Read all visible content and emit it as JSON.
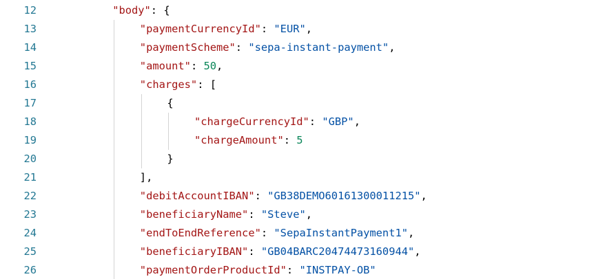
{
  "editor": {
    "lines": [
      {
        "number": "12",
        "indent": 2,
        "tokens": [
          {
            "t": "key",
            "v": "\"body\""
          },
          {
            "t": "pun",
            "v": ": {"
          }
        ]
      },
      {
        "number": "13",
        "indent": 3,
        "tokens": [
          {
            "t": "key",
            "v": "\"paymentCurrencyId\""
          },
          {
            "t": "pun",
            "v": ": "
          },
          {
            "t": "str",
            "v": "\"EUR\""
          },
          {
            "t": "pun",
            "v": ","
          }
        ]
      },
      {
        "number": "14",
        "indent": 3,
        "tokens": [
          {
            "t": "key",
            "v": "\"paymentScheme\""
          },
          {
            "t": "pun",
            "v": ": "
          },
          {
            "t": "str",
            "v": "\"sepa-instant-payment\""
          },
          {
            "t": "pun",
            "v": ","
          }
        ]
      },
      {
        "number": "15",
        "indent": 3,
        "tokens": [
          {
            "t": "key",
            "v": "\"amount\""
          },
          {
            "t": "pun",
            "v": ": "
          },
          {
            "t": "num",
            "v": "50"
          },
          {
            "t": "pun",
            "v": ","
          }
        ]
      },
      {
        "number": "16",
        "indent": 3,
        "tokens": [
          {
            "t": "key",
            "v": "\"charges\""
          },
          {
            "t": "pun",
            "v": ": ["
          }
        ]
      },
      {
        "number": "17",
        "indent": 4,
        "tokens": [
          {
            "t": "pun",
            "v": "{"
          }
        ]
      },
      {
        "number": "18",
        "indent": 5,
        "tokens": [
          {
            "t": "key",
            "v": "\"chargeCurrencyId\""
          },
          {
            "t": "pun",
            "v": ": "
          },
          {
            "t": "str",
            "v": "\"GBP\""
          },
          {
            "t": "pun",
            "v": ","
          }
        ]
      },
      {
        "number": "19",
        "indent": 5,
        "tokens": [
          {
            "t": "key",
            "v": "\"chargeAmount\""
          },
          {
            "t": "pun",
            "v": ": "
          },
          {
            "t": "num",
            "v": "5"
          }
        ]
      },
      {
        "number": "20",
        "indent": 4,
        "tokens": [
          {
            "t": "pun",
            "v": "}"
          }
        ]
      },
      {
        "number": "21",
        "indent": 3,
        "tokens": [
          {
            "t": "pun",
            "v": "],"
          }
        ]
      },
      {
        "number": "22",
        "indent": 3,
        "tokens": [
          {
            "t": "key",
            "v": "\"debitAccountIBAN\""
          },
          {
            "t": "pun",
            "v": ": "
          },
          {
            "t": "str",
            "v": "\"GB38DEMO60161300011215\""
          },
          {
            "t": "pun",
            "v": ","
          }
        ]
      },
      {
        "number": "23",
        "indent": 3,
        "tokens": [
          {
            "t": "key",
            "v": "\"beneficiaryName\""
          },
          {
            "t": "pun",
            "v": ": "
          },
          {
            "t": "str",
            "v": "\"Steve\""
          },
          {
            "t": "pun",
            "v": ","
          }
        ]
      },
      {
        "number": "24",
        "indent": 3,
        "tokens": [
          {
            "t": "key",
            "v": "\"endToEndReference\""
          },
          {
            "t": "pun",
            "v": ": "
          },
          {
            "t": "str",
            "v": "\"SepaInstantPayment1\""
          },
          {
            "t": "pun",
            "v": ","
          }
        ]
      },
      {
        "number": "25",
        "indent": 3,
        "tokens": [
          {
            "t": "key",
            "v": "\"beneficiaryIBAN\""
          },
          {
            "t": "pun",
            "v": ": "
          },
          {
            "t": "str",
            "v": "\"GB04BARC20474473160944\""
          },
          {
            "t": "pun",
            "v": ","
          }
        ]
      },
      {
        "number": "26",
        "indent": 3,
        "tokens": [
          {
            "t": "key",
            "v": "\"paymentOrderProductId\""
          },
          {
            "t": "pun",
            "v": ": "
          },
          {
            "t": "str",
            "v": "\"INSTPAY-OB\""
          }
        ]
      }
    ]
  },
  "colors": {
    "line_number": "#237893",
    "json_key": "#a31515",
    "json_string": "#0451a5",
    "json_number": "#098658",
    "indent_guide": "#d3d3d3"
  }
}
